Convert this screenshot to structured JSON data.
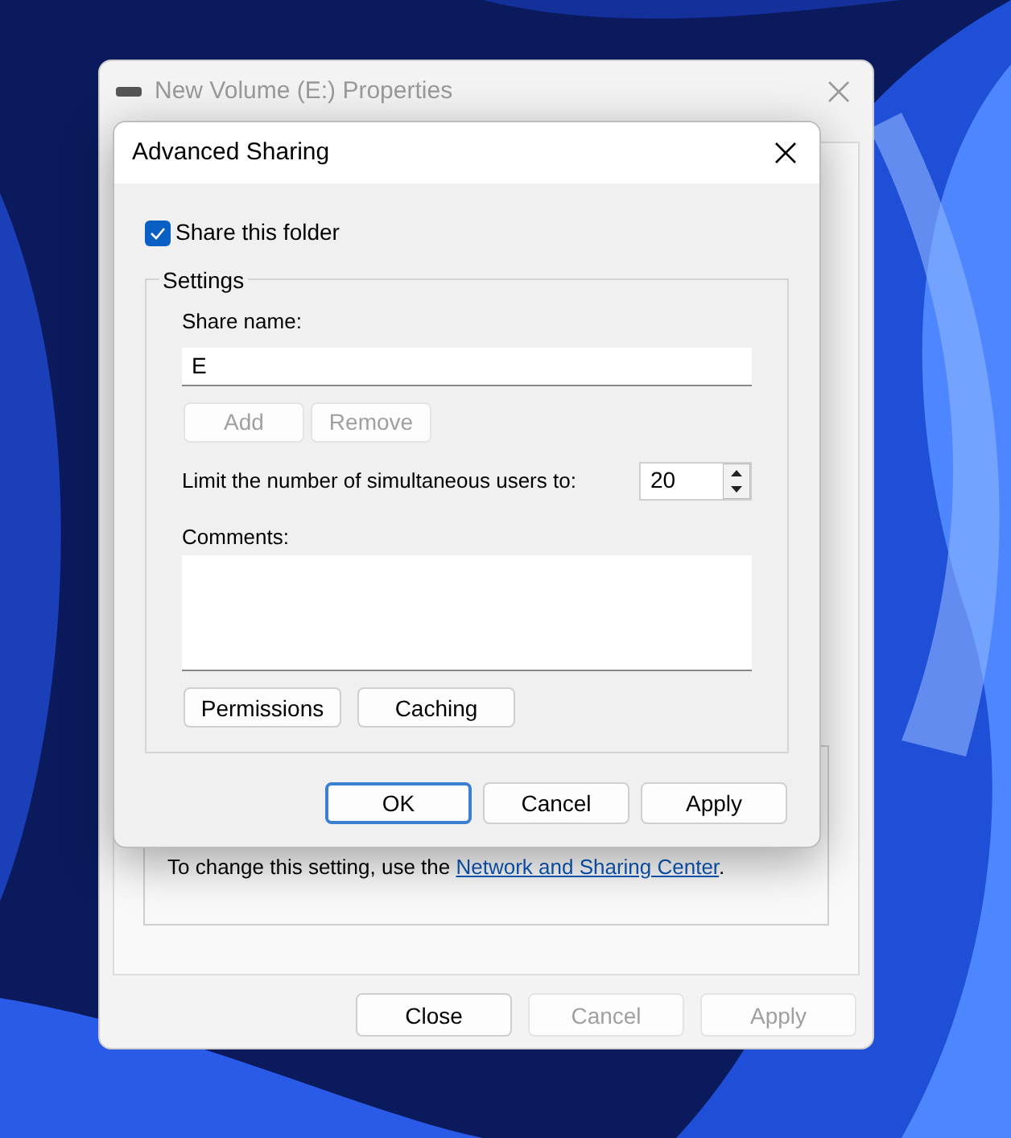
{
  "back_window": {
    "title": "New Volume (E:) Properties",
    "note": {
      "before": "To change this setting, use the ",
      "link": "Network and Sharing Center",
      "after": "."
    },
    "buttons": [
      {
        "label": "Close",
        "disabled": false
      },
      {
        "label": "Cancel",
        "disabled": true
      },
      {
        "label": "Apply",
        "disabled": true
      }
    ]
  },
  "dialog": {
    "title": "Advanced Sharing",
    "share_checkbox": {
      "label": "Share this folder",
      "checked": true
    },
    "settings": {
      "title": "Settings",
      "share_name_label": "Share name:",
      "share_name": "E",
      "name_buttons": [
        {
          "label": "Add",
          "disabled": true
        },
        {
          "label": "Remove",
          "disabled": true
        }
      ],
      "limit_label": "Limit the number of simultaneous users to:",
      "limit_value": "20",
      "comments_label": "Comments:",
      "buttons": [
        {
          "label": "Permissions",
          "disabled": false
        },
        {
          "label": "Caching",
          "disabled": false
        }
      ]
    },
    "buttons": [
      {
        "label": "OK",
        "default": true
      },
      {
        "label": "Cancel",
        "default": false
      },
      {
        "label": "Apply",
        "default": false
      }
    ]
  }
}
